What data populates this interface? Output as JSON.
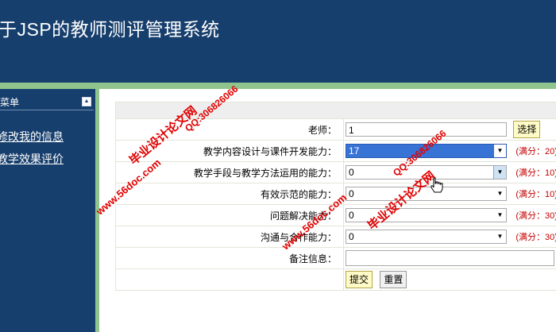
{
  "header": {
    "title": "于JSP的教师测评管理系统"
  },
  "sidebar": {
    "menu_label": "菜单",
    "collapse_glyph": "▲",
    "items": [
      {
        "label": "修改我的信息"
      },
      {
        "label": "教学效果评价"
      }
    ]
  },
  "form": {
    "teacher": {
      "label": "老师：",
      "value": "1",
      "choose_button": "选择"
    },
    "rows": [
      {
        "label": "教学内容设计与课件开发能力：",
        "value": "17",
        "max": "(满分：20)"
      },
      {
        "label": "教学手段与教学方法运用的能力：",
        "value": "0",
        "max": "(满分：10)"
      },
      {
        "label": "有效示范的能力：",
        "value": "0",
        "max": "(满分：10)"
      },
      {
        "label": "问题解决能力：",
        "value": "0",
        "max": "(满分：30)"
      },
      {
        "label": "沟通与合作能力：",
        "value": "0",
        "max": "(满分：30)"
      }
    ],
    "remarks": {
      "label": "备注信息：",
      "value": ""
    },
    "submit_button": "提交",
    "reset_button": "重置"
  },
  "watermarks": {
    "brand": "毕业设计论文网",
    "site": "www.56doc.com",
    "qq": "QQ:306826066"
  },
  "colors": {
    "header_bg": "#173f6d",
    "accent_green": "#8fc58c",
    "score_red": "#c40000",
    "select_highlight": "#3873d6",
    "watermark_red": "#e00000"
  }
}
